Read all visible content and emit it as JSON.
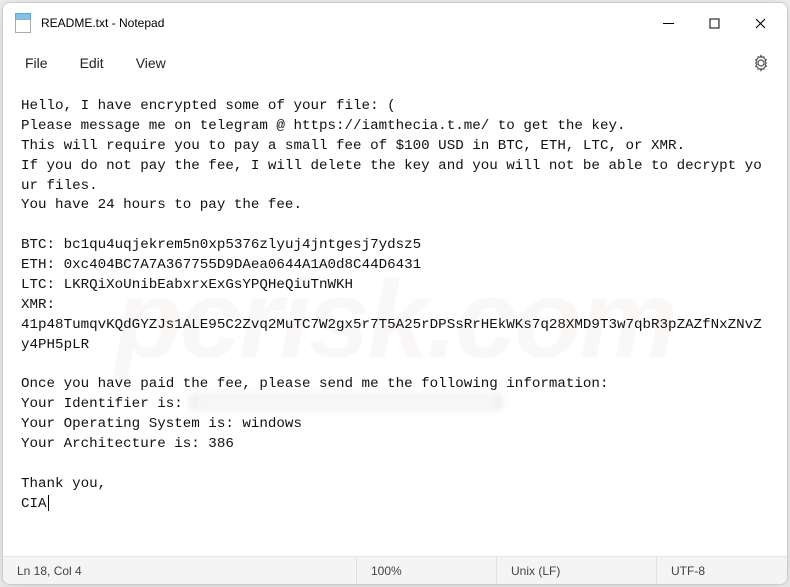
{
  "title": "README.txt - Notepad",
  "menus": {
    "file": "File",
    "edit": "Edit",
    "view": "View"
  },
  "body": {
    "greeting": "Hello, I have encrypted some of your file: (",
    "msg_line": "Please message me on telegram @ https://iamthecia.t.me/ to get the key.",
    "fee_line": "This will require you to pay a small fee of $100 USD in BTC, ETH, LTC, or XMR.",
    "nopay_line": "If you do not pay the fee, I will delete the key and you will not be able to decrypt your files.",
    "deadline": "You have 24 hours to pay the fee.",
    "btc_label": "BTC: ",
    "btc": "bc1qu4uqjekrem5n0xp5376zlyuj4jntgesj7ydsz5",
    "eth_label": "ETH: ",
    "eth": "0xc404BC7A7A367755D9DAea0644A1A0d8C44D6431",
    "ltc_label": "LTC: ",
    "ltc": "LKRQiXoUnibEabxrxExGsYPQHeQiuTnWKH",
    "xmr_label": "XMR:",
    "xmr": "41p48TumqvKQdGYZJs1ALE95C2Zvq2MuTC7W2gx5r7T5A25rDPSsRrHEkWKs7q28XMD9T3w7qbR3pZAZfNxZNvZy4PH5pLR",
    "paid_line": "Once you have paid the fee, please send me the following information:",
    "id_label": "Your Identifier is: ",
    "os_line": "Your Operating System is: windows",
    "arch_line": "Your Architecture is: 386",
    "thanks": "Thank you,",
    "sig": "CIA"
  },
  "status": {
    "pos": "Ln 18, Col 4",
    "zoom": "100%",
    "eol": "Unix (LF)",
    "enc": "UTF-8"
  },
  "watermark": "pcrisk.com"
}
